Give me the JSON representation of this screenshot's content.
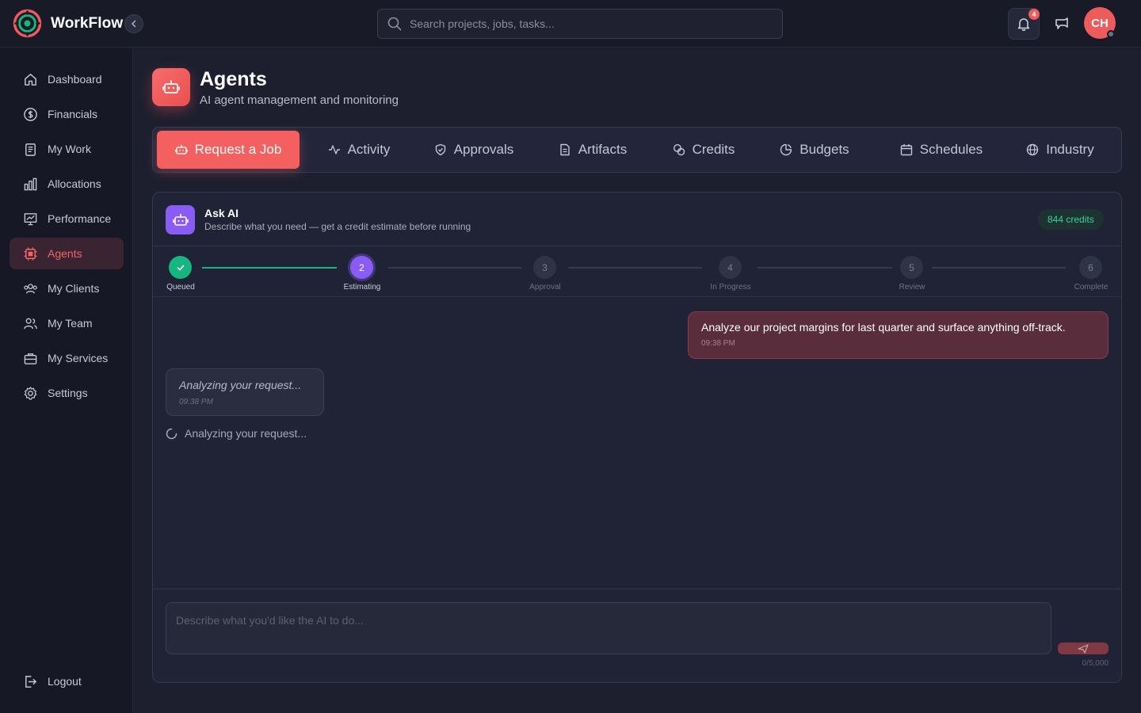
{
  "brand": {
    "name": "WorkFlow"
  },
  "search": {
    "placeholder": "Search projects, jobs, tasks..."
  },
  "header": {
    "notification_count": "4",
    "avatar_initials": "CH"
  },
  "sidebar": {
    "items": [
      {
        "label": "Dashboard",
        "icon": "home-icon"
      },
      {
        "label": "Financials",
        "icon": "dollar-icon"
      },
      {
        "label": "My Work",
        "icon": "clipboard-icon"
      },
      {
        "label": "Allocations",
        "icon": "bar-chart-icon"
      },
      {
        "label": "Performance",
        "icon": "presentation-chart-icon"
      },
      {
        "label": "Agents",
        "icon": "cpu-icon",
        "active": true
      },
      {
        "label": "My Clients",
        "icon": "users-group-icon"
      },
      {
        "label": "My Team",
        "icon": "team-icon"
      },
      {
        "label": "My Services",
        "icon": "briefcase-icon"
      },
      {
        "label": "Settings",
        "icon": "gear-icon"
      }
    ],
    "logout": "Logout"
  },
  "page": {
    "title": "Agents",
    "subtitle": "AI agent management and monitoring"
  },
  "tabs": [
    {
      "label": "Request a Job",
      "icon": "robot-icon",
      "active": true
    },
    {
      "label": "Activity",
      "icon": "activity-icon"
    },
    {
      "label": "Approvals",
      "icon": "shield-check-icon"
    },
    {
      "label": "Artifacts",
      "icon": "document-icon"
    },
    {
      "label": "Credits",
      "icon": "coins-icon"
    },
    {
      "label": "Budgets",
      "icon": "pie-chart-icon"
    },
    {
      "label": "Schedules",
      "icon": "calendar-icon"
    },
    {
      "label": "Industry",
      "icon": "globe-icon"
    }
  ],
  "ask_ai": {
    "title": "Ask AI",
    "description": "Describe what you need — get a credit estimate before running",
    "credits": "844 credits"
  },
  "steps": [
    {
      "number": "1",
      "label": "Queued",
      "state": "done"
    },
    {
      "number": "2",
      "label": "Estimating",
      "state": "current"
    },
    {
      "number": "3",
      "label": "Approval",
      "state": "pending"
    },
    {
      "number": "4",
      "label": "In Progress",
      "state": "pending"
    },
    {
      "number": "5",
      "label": "Review",
      "state": "pending"
    },
    {
      "number": "6",
      "label": "Complete",
      "state": "pending"
    }
  ],
  "messages": {
    "user": {
      "text": "Analyze our project margins for last quarter and surface anything off-track.",
      "time": "09:38 PM"
    },
    "ai": {
      "text": "Analyzing your request...",
      "time": "09:38 PM"
    },
    "status": "Analyzing your request..."
  },
  "composer": {
    "placeholder": "Describe what you'd like the AI to do...",
    "char_count": "0/5,000"
  },
  "colors": {
    "accent": "#f45f5f",
    "purple": "#8a5cf6",
    "success": "#17b57f"
  }
}
